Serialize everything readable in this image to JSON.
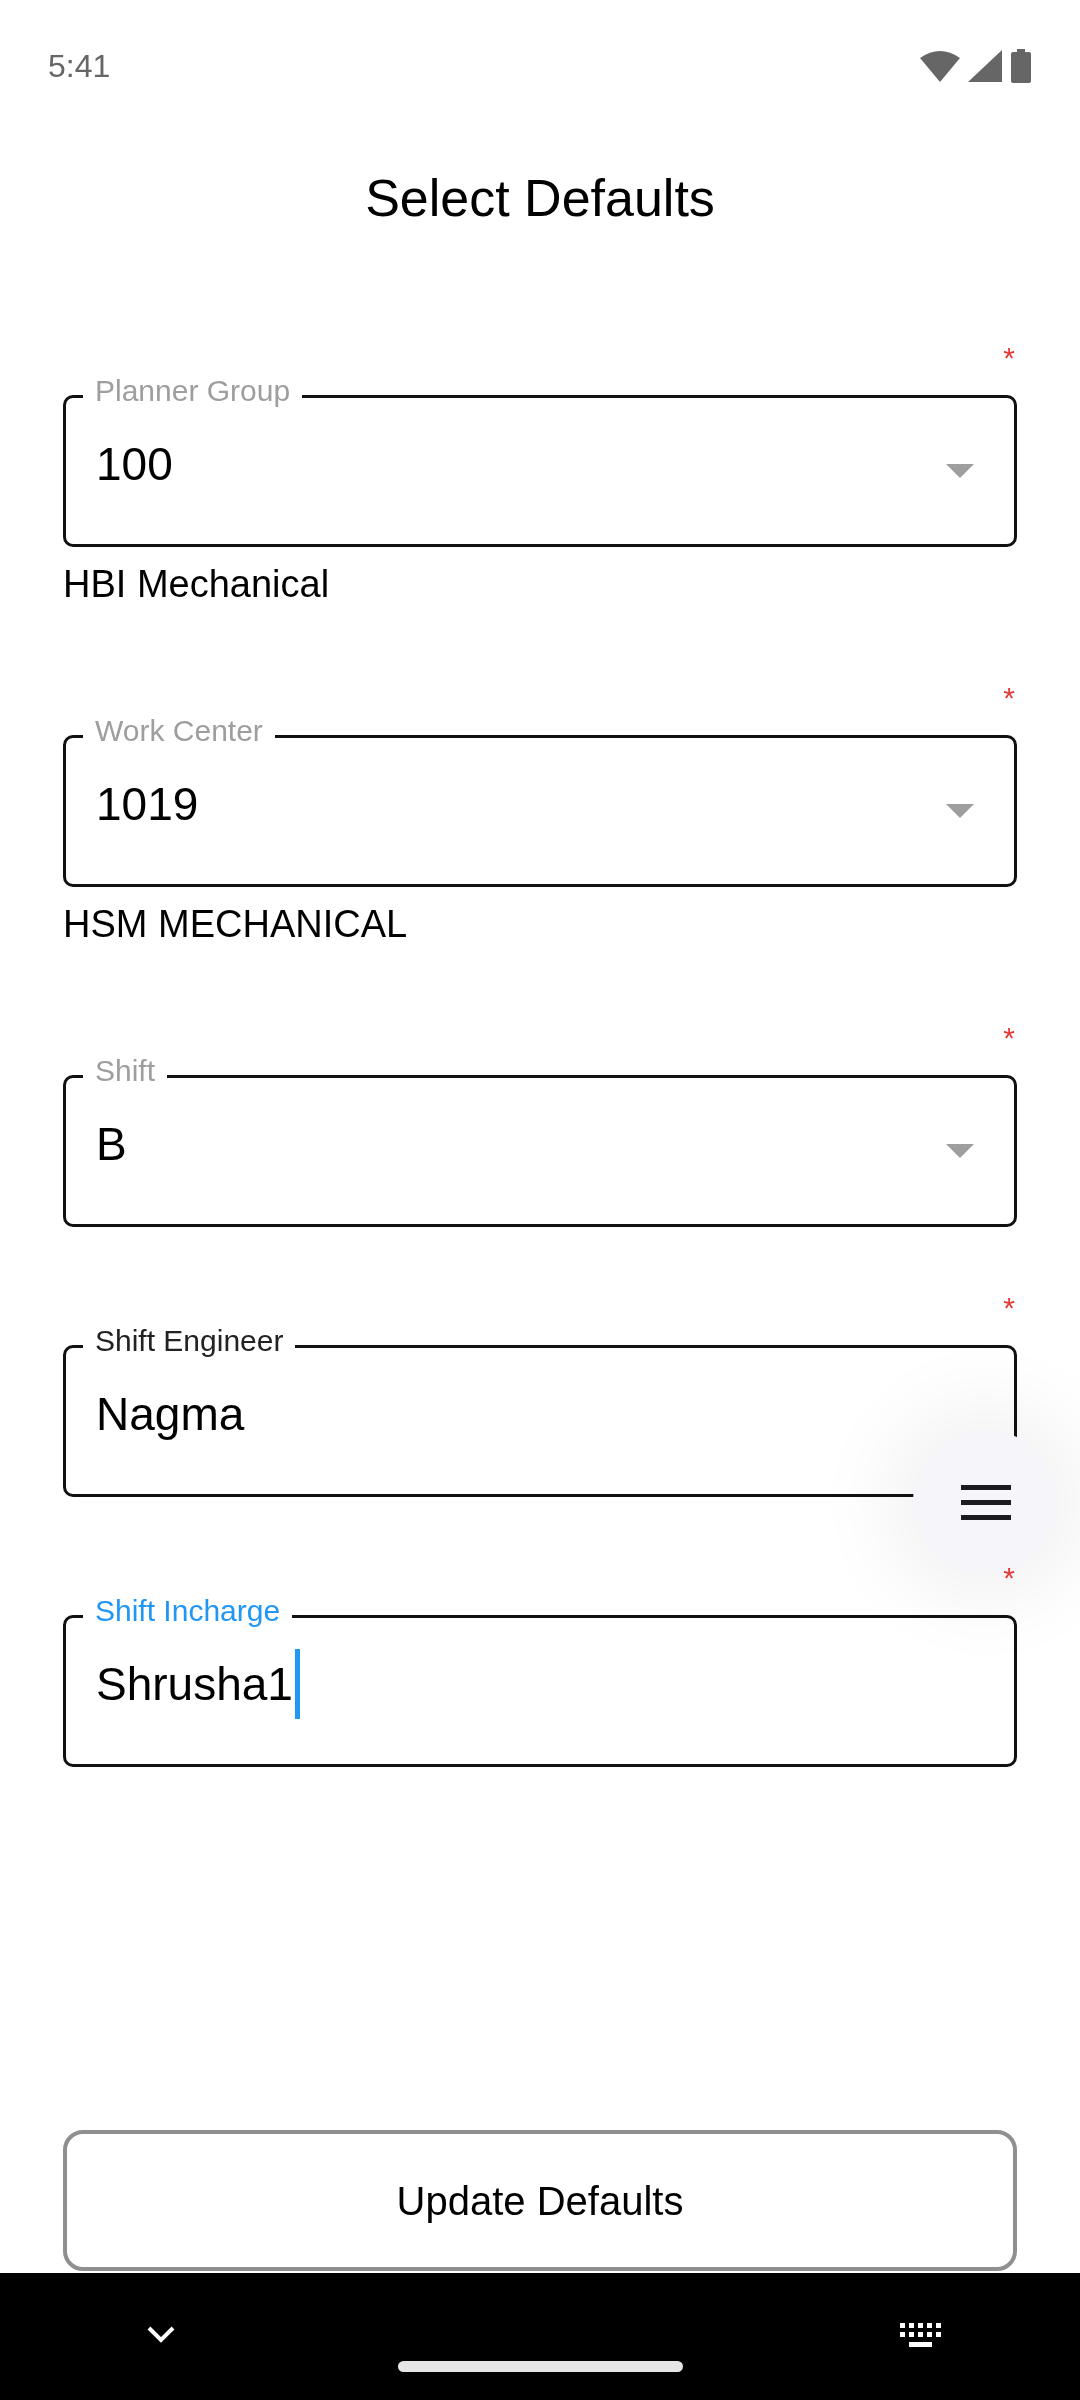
{
  "status_bar": {
    "time": "5:41"
  },
  "title": "Select Defaults",
  "fields": [
    {
      "kind": "dropdown",
      "label": "Planner Group",
      "value": "100",
      "required_mark": "*",
      "caption": "HBI Mechanical",
      "focused": false
    },
    {
      "kind": "dropdown",
      "label": "Work Center",
      "value": "1019",
      "required_mark": "*",
      "caption": "HSM MECHANICAL",
      "focused": false
    },
    {
      "kind": "dropdown",
      "label": "Shift",
      "value": "B",
      "required_mark": "*",
      "focused": false
    },
    {
      "kind": "text",
      "label": "Shift Engineer",
      "value": "Nagma",
      "required_mark": "*",
      "focused": false
    },
    {
      "kind": "text",
      "label": "Shift Incharge",
      "value": "Shrusha1",
      "required_mark": "*",
      "focused": true
    }
  ],
  "update_button": "Update Defaults"
}
